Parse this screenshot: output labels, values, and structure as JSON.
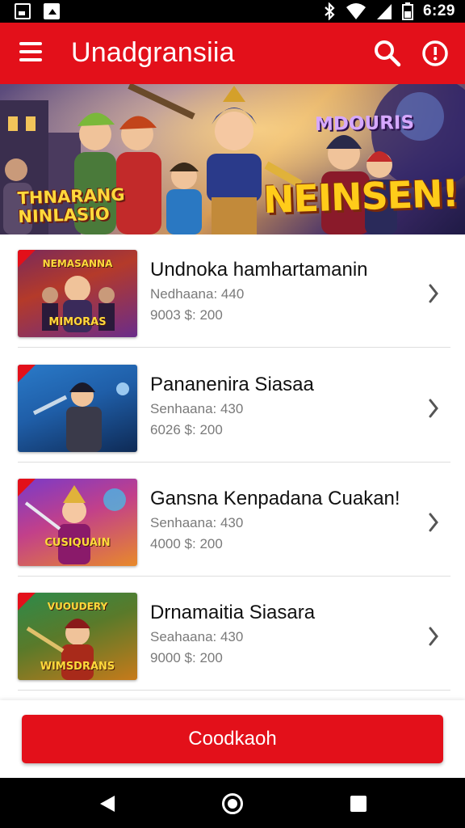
{
  "status_bar": {
    "time": "6:29",
    "icons": [
      "screenshot-icon",
      "gallery-icon",
      "bluetooth-icon",
      "wifi-icon",
      "signal-icon",
      "battery-icon"
    ]
  },
  "app_bar": {
    "title": "Unadgransiia",
    "icons": [
      "menu-icon",
      "search-icon",
      "info-icon"
    ],
    "color": "#e3101a"
  },
  "banner": {
    "left_text_line1": "THNARANG",
    "left_text_line2": "NINLASIO",
    "top_right_text": "MDOURIS",
    "main_text": "NEINSEN!"
  },
  "games": [
    {
      "title": "Undnoka hamhartamanin",
      "subtitle": "Nedhaana: 440",
      "price": "9003 $: 200",
      "thumb_top": "NEMASANNA",
      "thumb_label": "MIMORAS",
      "colors": [
        "#b43a2a",
        "#6a2c8a"
      ]
    },
    {
      "title": "Pananenira Siasaa",
      "subtitle": "Senhaana: 430",
      "price": "6026 $: 200",
      "thumb_top": "",
      "thumb_label": "",
      "colors": [
        "#1f5ea8",
        "#0e2a55"
      ]
    },
    {
      "title": "Gansna Kenpadana Cuakan!",
      "subtitle": "Senhaana: 430",
      "price": "4000 $: 200",
      "thumb_top": "",
      "thumb_label": "CUSIQUAIN",
      "colors": [
        "#c2408a",
        "#e88a2a"
      ]
    },
    {
      "title": "Drnamaitia Siasara",
      "subtitle": "Seahaana: 430",
      "price": "9000 $: 200",
      "thumb_top": "VUOUDERY",
      "thumb_label": "WIMSDRANS",
      "colors": [
        "#2d8a4a",
        "#c77a1a"
      ]
    }
  ],
  "cta": {
    "label": "Coodkaoh"
  }
}
